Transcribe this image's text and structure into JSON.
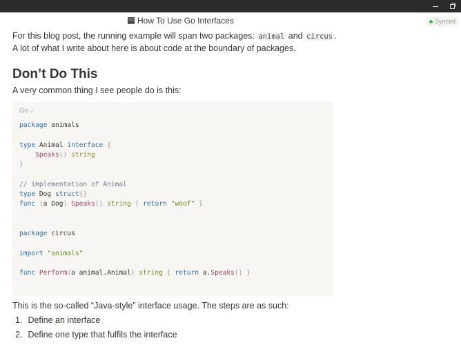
{
  "doc": {
    "title": "How To Use Go Interfaces",
    "sync_status": "Synced"
  },
  "intro": {
    "before": "For this blog post, the running example will span two packages: ",
    "code1": "animal",
    "mid": " and ",
    "code2": "circus",
    "after": ". A lot of what I write about here is about code at the boundary of packages."
  },
  "heading": "Don’t Do This",
  "lead": "A very common thing I see people do is this:",
  "code_block": {
    "language": "Go",
    "lines": [
      "package animals",
      "",
      "type Animal interface {",
      "    Speaks() string",
      "}",
      "",
      "// implementation of Animal",
      "type Dog struct{}",
      "func (a Dog) Speaks() string { return \"woof\" }",
      "",
      "",
      "package circus",
      "",
      "import \"animals\"",
      "",
      "func Perform(a animal.Animal) string { return a.Speaks() }"
    ]
  },
  "after_code": "This is the so-called “Java-style” interface usage. The steps are as such:",
  "steps": [
    {
      "num": "1.",
      "text": "Define an interface"
    },
    {
      "num": "2.",
      "text": "Define one type that fulfils the interface"
    }
  ],
  "colors": {
    "keyword": "#2a6ea6",
    "type": "#7d8b2b",
    "function": "#a0456c",
    "string": "#6b8e23",
    "comment": "#6f7c8a",
    "code_bg": "#f7f6f3",
    "topbar": "#2b2b2b",
    "synced_dot": "#3fb950"
  },
  "icons": [
    "window-minimize-icon",
    "window-maximize-icon",
    "page-icon",
    "synced-dot-icon",
    "chevron-down-icon"
  ]
}
